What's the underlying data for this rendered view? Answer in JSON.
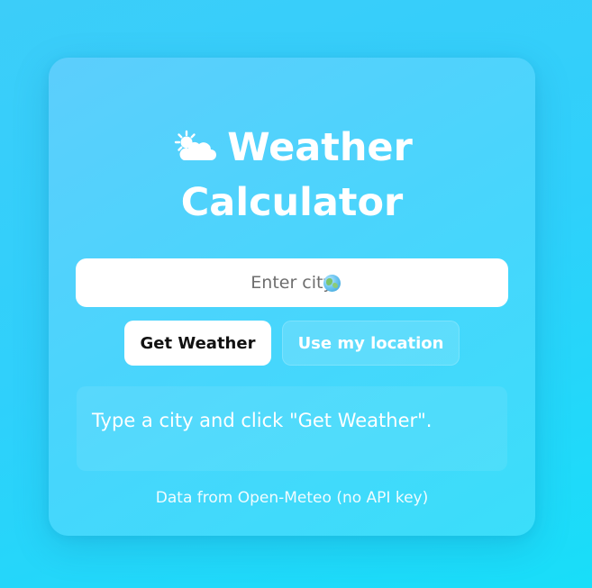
{
  "app": {
    "title_line1": "Weather",
    "title_line2": "Calculator",
    "title_icon": "sun-behind-cloud-icon"
  },
  "search": {
    "placeholder": "Enter city",
    "placeholder_icon": "globe-icon",
    "value": ""
  },
  "actions": {
    "get_weather_label": "Get Weather",
    "use_location_label": "Use my location"
  },
  "result": {
    "message": "Type a city and click \"Get Weather\"."
  },
  "footer": {
    "text": "Data from Open-Meteo (no API key)"
  },
  "colors": {
    "background": "#2fd0fb",
    "card": "#5ecefc",
    "text": "#ffffff",
    "primary_button": "#ffffff",
    "primary_button_text": "#111111"
  }
}
